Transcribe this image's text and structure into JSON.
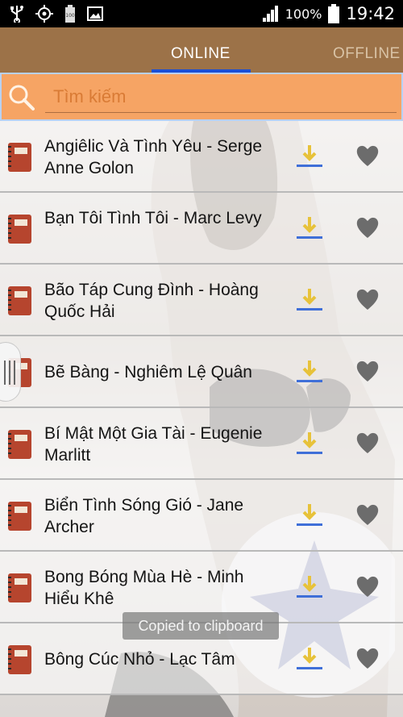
{
  "status_bar": {
    "battery_percent": "100%",
    "time": "19:42"
  },
  "tabs": [
    {
      "label": "ONLINE",
      "selected": true
    },
    {
      "label": "OFFLINE",
      "selected": false
    }
  ],
  "search": {
    "placeholder": "Tìm kiếm",
    "value": ""
  },
  "books": [
    {
      "title": "Angiêlic Và Tình Yêu - Serge Anne Golon"
    },
    {
      "title": "Bạn Tôi Tình Tôi - Marc Levy"
    },
    {
      "title": "Bão Táp Cung Đình - Hoàng Quốc Hải"
    },
    {
      "title": "Bẽ Bàng - Nghiêm Lệ Quân"
    },
    {
      "title": "Bí Mật Một Gia Tài - Eugenie Marlitt"
    },
    {
      "title": "Biển Tình Sóng Gió - Jane Archer"
    },
    {
      "title": "Bong Bóng Mùa Hè - Minh Hiểu Khê"
    },
    {
      "title": "Bông Cúc Nhỏ - Lạc Tâm"
    }
  ],
  "toast": "Copied to clipboard",
  "colors": {
    "tab_bar": "#9c7248",
    "tab_indicator": "#1a4fd6",
    "search_bar": "#f6a464",
    "placeholder": "#d97b35",
    "download_accent": "#3f6fd8",
    "download_arrow": "#e7c23a",
    "heart": "#6c6c6c",
    "book_icon": "#b6452e"
  }
}
